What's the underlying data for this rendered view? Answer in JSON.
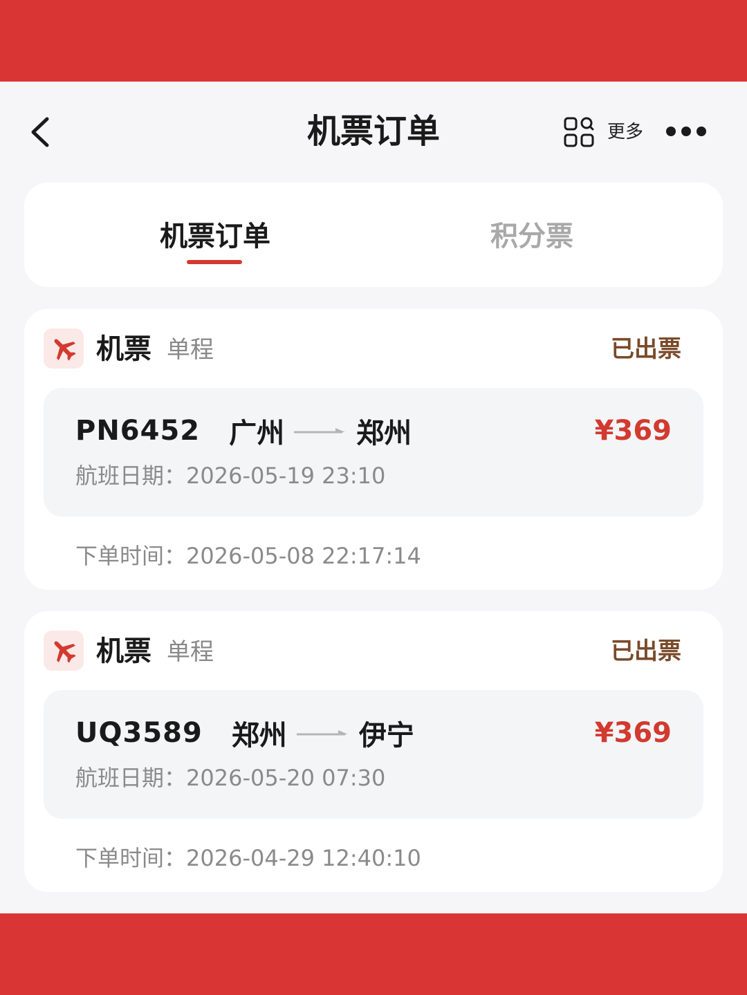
{
  "header": {
    "title": "机票订单",
    "more_label": "更多",
    "back_icon": "chevron-left-icon",
    "mini_program_icon": "grid-search-icon",
    "menu_icon": "more-dots-icon"
  },
  "tabs": [
    {
      "label": "机票订单",
      "active": true
    },
    {
      "label": "积分票",
      "active": false
    }
  ],
  "colors": {
    "brand_red": "#d93535",
    "price_red": "#d23a2f",
    "status_brown": "#7a4a2a"
  },
  "orders": [
    {
      "type": "机票",
      "trip": "单程",
      "status": "已出票",
      "flight_no": "PN6452",
      "from": "广州",
      "to": "郑州",
      "price": "¥369",
      "flight_date": "航班日期：2026-05-19 23:10",
      "order_time": "下单时间：2026-05-08 22:17:14"
    },
    {
      "type": "机票",
      "trip": "单程",
      "status": "已出票",
      "flight_no": "UQ3589",
      "from": "郑州",
      "to": "伊宁",
      "price": "¥369",
      "flight_date": "航班日期：2026-05-20 07:30",
      "order_time": "下单时间：2026-04-29 12:40:10"
    }
  ]
}
